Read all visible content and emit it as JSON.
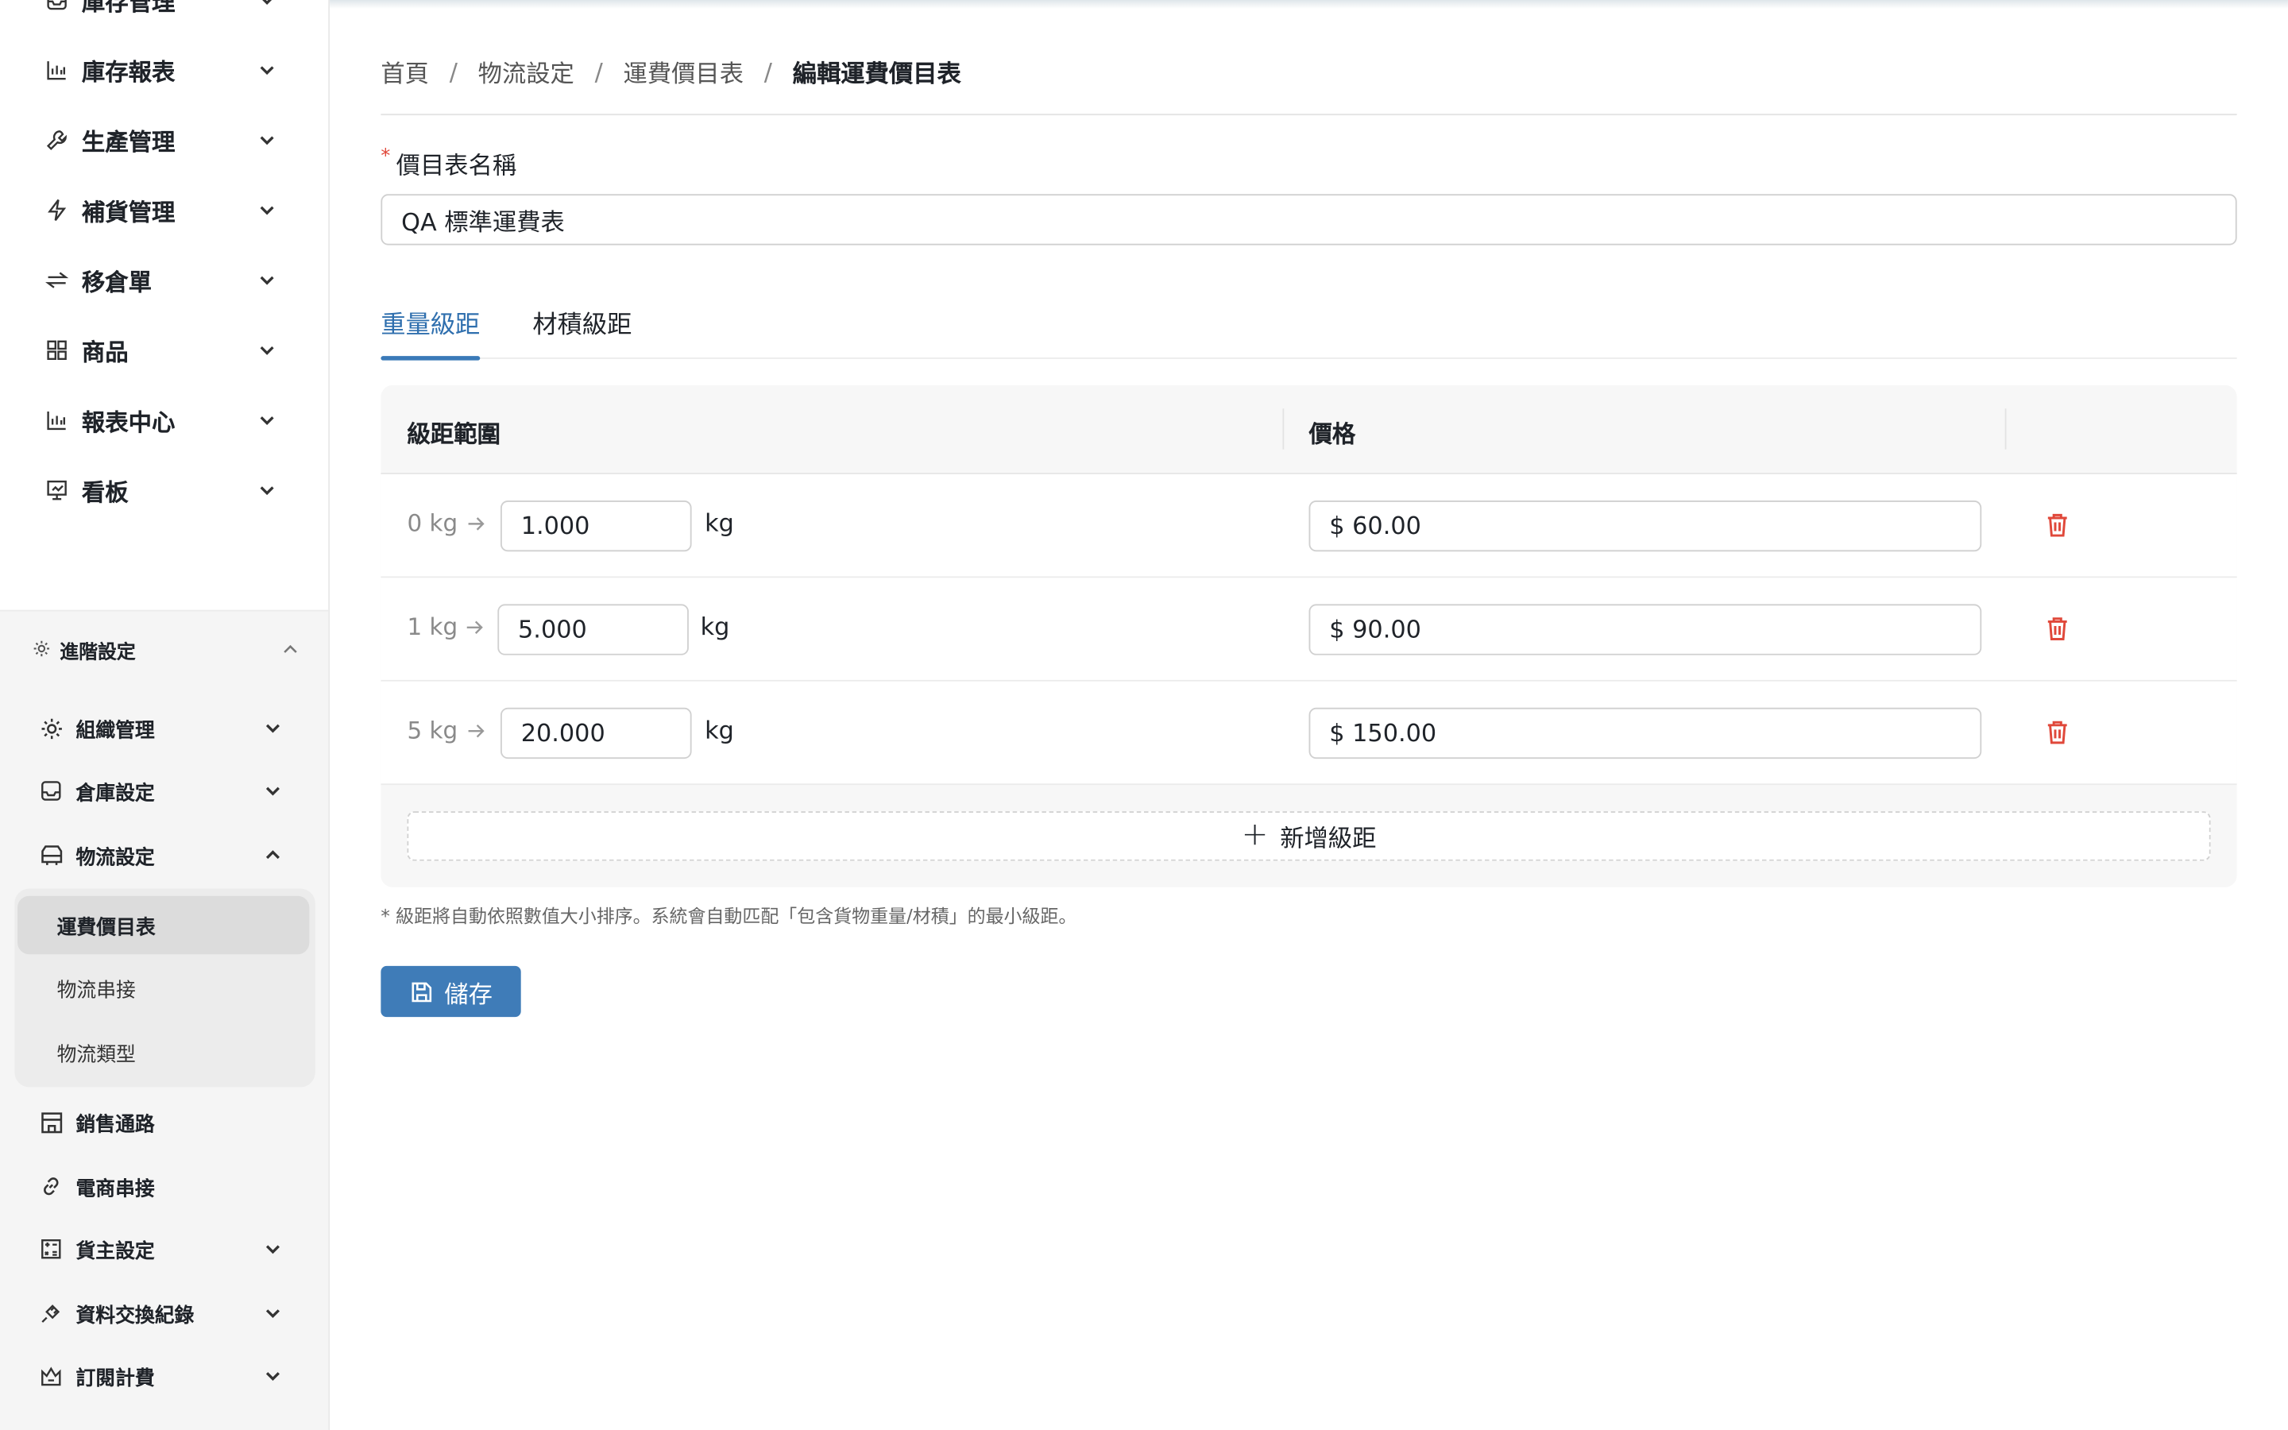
{
  "sidebar": {
    "menu": [
      {
        "label": "庫存管理",
        "icon": "inbox-icon"
      },
      {
        "label": "庫存報表",
        "icon": "bar-chart-icon"
      },
      {
        "label": "生產管理",
        "icon": "wrench-icon"
      },
      {
        "label": "補貨管理",
        "icon": "lightning-icon"
      },
      {
        "label": "移倉單",
        "icon": "transfer-icon"
      },
      {
        "label": "商品",
        "icon": "grid-icon"
      },
      {
        "label": "報表中心",
        "icon": "bar-chart-icon"
      },
      {
        "label": "看板",
        "icon": "presentation-icon"
      }
    ],
    "advanced": {
      "title": "進階設定",
      "items": [
        {
          "label": "組織管理",
          "icon": "gear-icon"
        },
        {
          "label": "倉庫設定",
          "icon": "inbox-icon"
        },
        {
          "label": "物流設定",
          "icon": "truck-icon"
        }
      ],
      "logistics_children": [
        {
          "label": "運費價目表",
          "active": true
        },
        {
          "label": "物流串接",
          "active": false
        },
        {
          "label": "物流類型",
          "active": false
        }
      ],
      "more": [
        {
          "label": "銷售通路",
          "icon": "store-icon"
        },
        {
          "label": "電商串接",
          "icon": "link-icon"
        },
        {
          "label": "貨主設定",
          "icon": "calculator-icon"
        },
        {
          "label": "資料交換紀錄",
          "icon": "plug-icon"
        },
        {
          "label": "訂閱計費",
          "icon": "crown-icon"
        }
      ]
    }
  },
  "breadcrumb": [
    "首頁",
    "物流設定",
    "運費價目表",
    "編輯運費價目表"
  ],
  "form": {
    "name_label": "價目表名稱",
    "required_mark": "*",
    "name_value": "QA 標準運費表"
  },
  "tabs": [
    {
      "label": "重量級距",
      "active": true
    },
    {
      "label": "材積級距",
      "active": false
    }
  ],
  "table": {
    "headers": [
      "級距範圍",
      "價格"
    ],
    "rows": [
      {
        "from": "0 kg",
        "to": "1.000",
        "unit": "kg",
        "price": "$ 60.00"
      },
      {
        "from": "1 kg",
        "to": "5.000",
        "unit": "kg",
        "price": "$ 90.00"
      },
      {
        "from": "5 kg",
        "to": "20.000",
        "unit": "kg",
        "price": "$ 150.00"
      }
    ],
    "add_label": "新增級距"
  },
  "note": "* 級距將自動依照數值大小排序。系統會自動匹配「包含貨物重量/材積」的最小級距。",
  "save_label": "儲存",
  "colors": {
    "accent": "#3f7cb8",
    "danger": "#e0483a",
    "sidebar_active": "#dcdcdc"
  }
}
